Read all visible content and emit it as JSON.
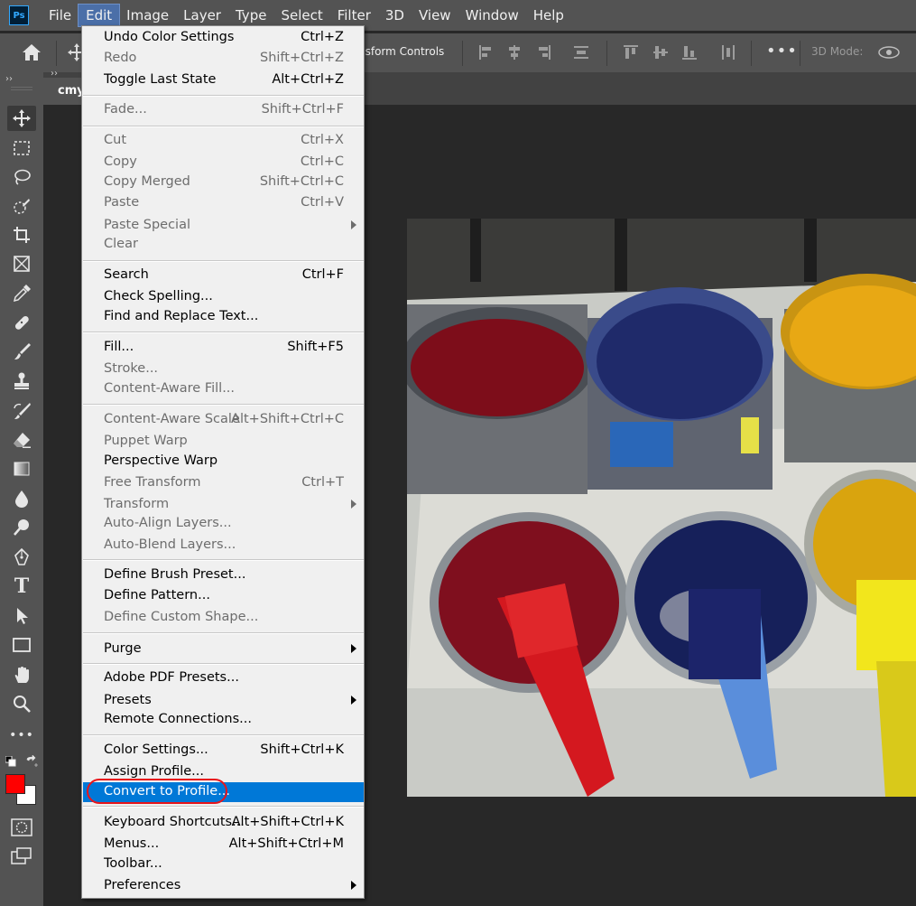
{
  "app": {
    "logo_text": "Ps"
  },
  "menubar": {
    "items": [
      {
        "label": "File"
      },
      {
        "label": "Edit"
      },
      {
        "label": "Image"
      },
      {
        "label": "Layer"
      },
      {
        "label": "Type"
      },
      {
        "label": "Select"
      },
      {
        "label": "Filter"
      },
      {
        "label": "3D"
      },
      {
        "label": "View"
      },
      {
        "label": "Window"
      },
      {
        "label": "Help"
      }
    ],
    "active": "Edit"
  },
  "options_bar": {
    "transform_controls_label": "nsform Controls",
    "more_label": "•••",
    "mode3d_label": "3D Mode:"
  },
  "toolbar": {
    "collapse_glyph": "››",
    "tools": [
      "move-tool",
      "marquee-tool",
      "lasso-tool",
      "quick-selection-tool",
      "crop-tool",
      "frame-tool",
      "eyedropper-tool",
      "healing-brush-tool",
      "brush-tool",
      "clone-stamp-tool",
      "history-brush-tool",
      "eraser-tool",
      "gradient-tool",
      "blur-tool",
      "dodge-tool",
      "pen-tool",
      "type-tool",
      "path-selection-tool",
      "rectangle-tool",
      "hand-tool",
      "zoom-tool",
      "more-tools"
    ],
    "more_tools_label": "•••",
    "type_tool_glyph": "T",
    "foreground_color": "#ff0000",
    "background_color": "#ffffff"
  },
  "document": {
    "tab_title": "cmy",
    "tab_collapse_glyph": "››"
  },
  "edit_menu": {
    "items": [
      {
        "label": "Undo Color Settings",
        "shortcut": "Ctrl+Z",
        "enabled": true
      },
      {
        "label": "Redo",
        "shortcut": "Shift+Ctrl+Z",
        "enabled": false
      },
      {
        "label": "Toggle Last State",
        "shortcut": "Alt+Ctrl+Z",
        "enabled": true
      },
      {
        "label": "Fade...",
        "shortcut": "Shift+Ctrl+F",
        "enabled": false
      },
      {
        "label": "Cut",
        "shortcut": "Ctrl+X",
        "enabled": false
      },
      {
        "label": "Copy",
        "shortcut": "Ctrl+C",
        "enabled": false
      },
      {
        "label": "Copy Merged",
        "shortcut": "Shift+Ctrl+C",
        "enabled": false
      },
      {
        "label": "Paste",
        "shortcut": "Ctrl+V",
        "enabled": false
      },
      {
        "label": "Paste Special",
        "shortcut": "",
        "enabled": false,
        "submenu": true
      },
      {
        "label": "Clear",
        "shortcut": "",
        "enabled": false
      },
      {
        "label": "Search",
        "shortcut": "Ctrl+F",
        "enabled": true
      },
      {
        "label": "Check Spelling...",
        "shortcut": "",
        "enabled": true
      },
      {
        "label": "Find and Replace Text...",
        "shortcut": "",
        "enabled": true
      },
      {
        "label": "Fill...",
        "shortcut": "Shift+F5",
        "enabled": true
      },
      {
        "label": "Stroke...",
        "shortcut": "",
        "enabled": false
      },
      {
        "label": "Content-Aware Fill...",
        "shortcut": "",
        "enabled": false
      },
      {
        "label": "Content-Aware Scale",
        "shortcut": "Alt+Shift+Ctrl+C",
        "enabled": false
      },
      {
        "label": "Puppet Warp",
        "shortcut": "",
        "enabled": false
      },
      {
        "label": "Perspective Warp",
        "shortcut": "",
        "enabled": true
      },
      {
        "label": "Free Transform",
        "shortcut": "Ctrl+T",
        "enabled": false
      },
      {
        "label": "Transform",
        "shortcut": "",
        "enabled": false,
        "submenu": true
      },
      {
        "label": "Auto-Align Layers...",
        "shortcut": "",
        "enabled": false
      },
      {
        "label": "Auto-Blend Layers...",
        "shortcut": "",
        "enabled": false
      },
      {
        "label": "Define Brush Preset...",
        "shortcut": "",
        "enabled": true
      },
      {
        "label": "Define Pattern...",
        "shortcut": "",
        "enabled": true
      },
      {
        "label": "Define Custom Shape...",
        "shortcut": "",
        "enabled": false
      },
      {
        "label": "Purge",
        "shortcut": "",
        "enabled": true,
        "submenu": true
      },
      {
        "label": "Adobe PDF Presets...",
        "shortcut": "",
        "enabled": true
      },
      {
        "label": "Presets",
        "shortcut": "",
        "enabled": true,
        "submenu": true
      },
      {
        "label": "Remote Connections...",
        "shortcut": "",
        "enabled": true
      },
      {
        "label": "Color Settings...",
        "shortcut": "Shift+Ctrl+K",
        "enabled": true
      },
      {
        "label": "Assign Profile...",
        "shortcut": "",
        "enabled": true
      },
      {
        "label": "Convert to Profile...",
        "shortcut": "",
        "enabled": true,
        "highlighted": true,
        "annotated": true
      },
      {
        "label": "Keyboard Shortcuts...",
        "shortcut": "Alt+Shift+Ctrl+K",
        "enabled": true
      },
      {
        "label": "Menus...",
        "shortcut": "Alt+Shift+Ctrl+M",
        "enabled": true
      },
      {
        "label": "Toolbar...",
        "shortcut": "",
        "enabled": true
      },
      {
        "label": "Preferences",
        "shortcut": "",
        "enabled": true,
        "submenu": true
      }
    ]
  },
  "colors": {
    "menubar_bg": "#535353",
    "menu_bg": "#f0f0f0",
    "highlight": "#0078d7",
    "annotation": "#e8151b",
    "ps_brand": "#31a8ff"
  }
}
